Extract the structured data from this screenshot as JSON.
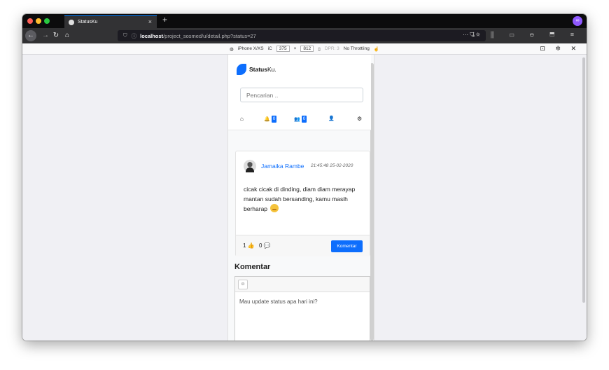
{
  "browser": {
    "tab_title": "StatusKu",
    "tab_close": "×",
    "new_tab": "+",
    "url_host": "localhost",
    "url_path": "/project_sosmed/u/detail.php?status=27",
    "url_actions": "··· ⛉ ☆",
    "toolbar_right": "⤓ ⫼ ▭ ⊖ ⬒ ≡",
    "mask_icon": "∞"
  },
  "rdm": {
    "device": "iPhone X/XS",
    "orientation": "iC",
    "width": "375",
    "times": "×",
    "height": "812",
    "dpr": "DPR: 3",
    "throttling": "No Throttling",
    "right_icons": "⊡ ✲ ✕"
  },
  "app": {
    "brand_bold": "Status",
    "brand_rest": "Ku.",
    "search_placeholder": "Pencarian ..",
    "notif_count": "0",
    "friends_count": "0",
    "nav_home": "⌂",
    "nav_bell": "🔔",
    "nav_users": "👥",
    "nav_user": "👤",
    "nav_settings": "⚙"
  },
  "post": {
    "author": "Jamaika Rambe",
    "time": "21:45:48 25-02-2020",
    "line1": "cicak cicak di dinding, diam diam merayap",
    "line2": "mantan sudah bersanding, kamu masih berharap",
    "likes": "1",
    "comments": "0",
    "comment_button": "Komentar"
  },
  "comments": {
    "title": "Komentar",
    "emoji_button": "☺",
    "placeholder": "Mau update status apa hari ini?"
  },
  "colors": {
    "primary": "#0d6efd",
    "titlebar": "#0c0c0d",
    "toolbar": "#323234"
  }
}
